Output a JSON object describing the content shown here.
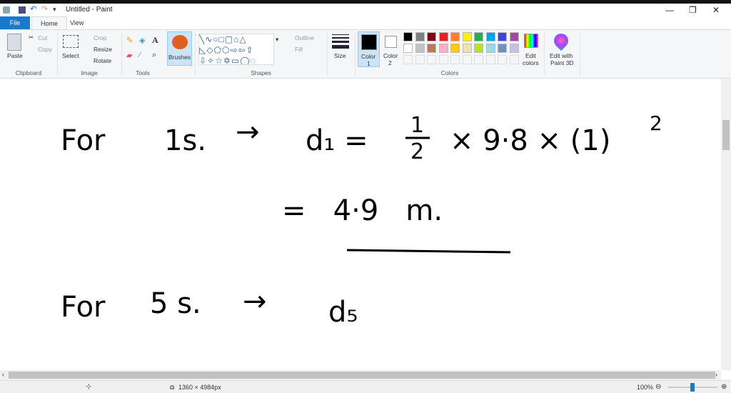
{
  "window": {
    "title": "Untitled - Paint"
  },
  "tabs": [
    {
      "label": "File"
    },
    {
      "label": "Home"
    },
    {
      "label": "View"
    }
  ],
  "ribbon": {
    "clipboard": {
      "group": "Clipboard",
      "paste": "Paste",
      "cut": "Cut",
      "copy": "Copy"
    },
    "image": {
      "group": "Image",
      "select": "Select",
      "crop": "Crop",
      "resize": "Resize",
      "rotate": "Rotate"
    },
    "tools": {
      "group": "Tools"
    },
    "brushes": {
      "label": "Brushes"
    },
    "shapes": {
      "group": "Shapes",
      "outline": "Outline",
      "fill": "Fill"
    },
    "size": {
      "label": "Size"
    },
    "colors": {
      "group": "Colors",
      "color1": "Color",
      "color1_num": "1",
      "color2": "Color",
      "color2_num": "2",
      "edit": "Edit",
      "edit2": "colors",
      "palette_row1": [
        "#000000",
        "#7f7f7f",
        "#880015",
        "#ed1c24",
        "#ff7f27",
        "#fff200",
        "#22b14c",
        "#00a2e8",
        "#3f48cc",
        "#a349a4"
      ],
      "palette_row2": [
        "#ffffff",
        "#c3c3c3",
        "#b97a57",
        "#ffaec9",
        "#ffc90e",
        "#efe4b0",
        "#b5e61d",
        "#99d9ea",
        "#7092be",
        "#c8bfe7"
      ]
    },
    "paint3d": {
      "line1": "Edit with",
      "line2": "Paint 3D"
    }
  },
  "canvas_text": {
    "l1a": "For",
    "l1b": "1s.",
    "arrow": "→",
    "l1c": "d₁ =",
    "half_n": "1",
    "half_d": "2",
    "l1d": "× 9·8 × (1)",
    "sq": "2",
    "l2": "=   4·9   m.",
    "l3a": "For",
    "l3b": "5 s.",
    "l3c": "d₅"
  },
  "status": {
    "dimensions": "1360 × 4984px",
    "zoom": "100%",
    "zoom_fraction": 0.5
  }
}
